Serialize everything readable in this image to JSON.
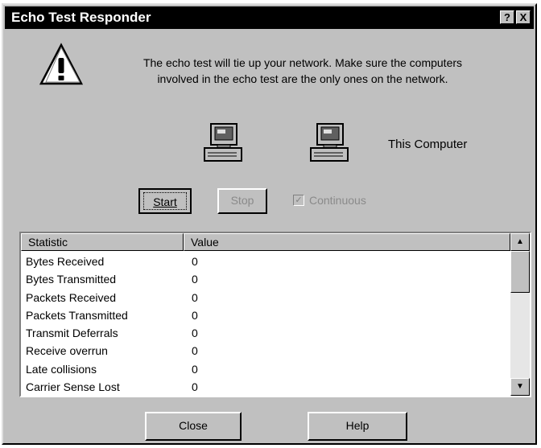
{
  "window": {
    "title": "Echo Test Responder",
    "help_glyph": "?",
    "close_glyph": "X"
  },
  "message": {
    "line1": "The echo test will tie up your network.  Make sure the computers",
    "line2": "involved in the echo test are the only ones on the network."
  },
  "icons": {
    "warning": "warning-icon",
    "computer": "computer-icon"
  },
  "this_computer_label": "This Computer",
  "controls": {
    "start_label": "Start",
    "stop_label": "Stop",
    "continuous_label": "Continuous",
    "continuous_checked": true
  },
  "table": {
    "columns": [
      "Statistic",
      "Value"
    ],
    "rows": [
      {
        "name": "Bytes Received",
        "value": "0"
      },
      {
        "name": "Bytes Transmitted",
        "value": "0"
      },
      {
        "name": "Packets Received",
        "value": "0"
      },
      {
        "name": "Packets Transmitted",
        "value": "0"
      },
      {
        "name": "Transmit Deferrals",
        "value": "0"
      },
      {
        "name": "Receive overrun",
        "value": "0"
      },
      {
        "name": "Late collisions",
        "value": "0"
      },
      {
        "name": "Carrier Sense Lost",
        "value": "0"
      }
    ]
  },
  "footer": {
    "close_label": "Close",
    "help_label": "Help"
  }
}
